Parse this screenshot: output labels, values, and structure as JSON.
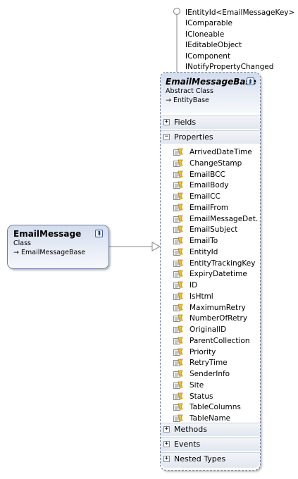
{
  "interface_lollipop": {
    "interfaces": [
      "IEntityId<EmailMessageKey>",
      "IComparable",
      "ICloneable",
      "IEditableObject",
      "IComponent",
      "INotifyPropertyChanged"
    ]
  },
  "email_message": {
    "name": "EmailMessage",
    "kind": "Class",
    "inherits": "EmailMessageBase",
    "toggle_icon": "chevron-double-down-icon"
  },
  "email_message_base": {
    "name": "EmailMessageBase",
    "kind": "Abstract Class",
    "inherits": "EntityBase",
    "toggle_icon": "chevron-double-up-icon",
    "sections": {
      "fields": {
        "label": "Fields",
        "expander": "+"
      },
      "properties": {
        "label": "Properties",
        "expander": "−"
      },
      "methods": {
        "label": "Methods",
        "expander": "+"
      },
      "events": {
        "label": "Events",
        "expander": "+"
      },
      "nested_types": {
        "label": "Nested Types",
        "expander": "+"
      }
    },
    "properties": [
      "ArrivedDateTime",
      "ChangeStamp",
      "EmailBCC",
      "EmailBody",
      "EmailCC",
      "EmailFrom",
      "EmailMessageDet...",
      "EmailSubject",
      "EmailTo",
      "EntityId",
      "EntityTrackingKey",
      "ExpiryDatetime",
      "ID",
      "IsHtml",
      "MaximumRetry",
      "NumberOfRetry",
      "OriginalID",
      "ParentCollection",
      "Priority",
      "RetryTime",
      "SenderInfo",
      "Site",
      "Status",
      "TableColumns",
      "TableName"
    ]
  }
}
